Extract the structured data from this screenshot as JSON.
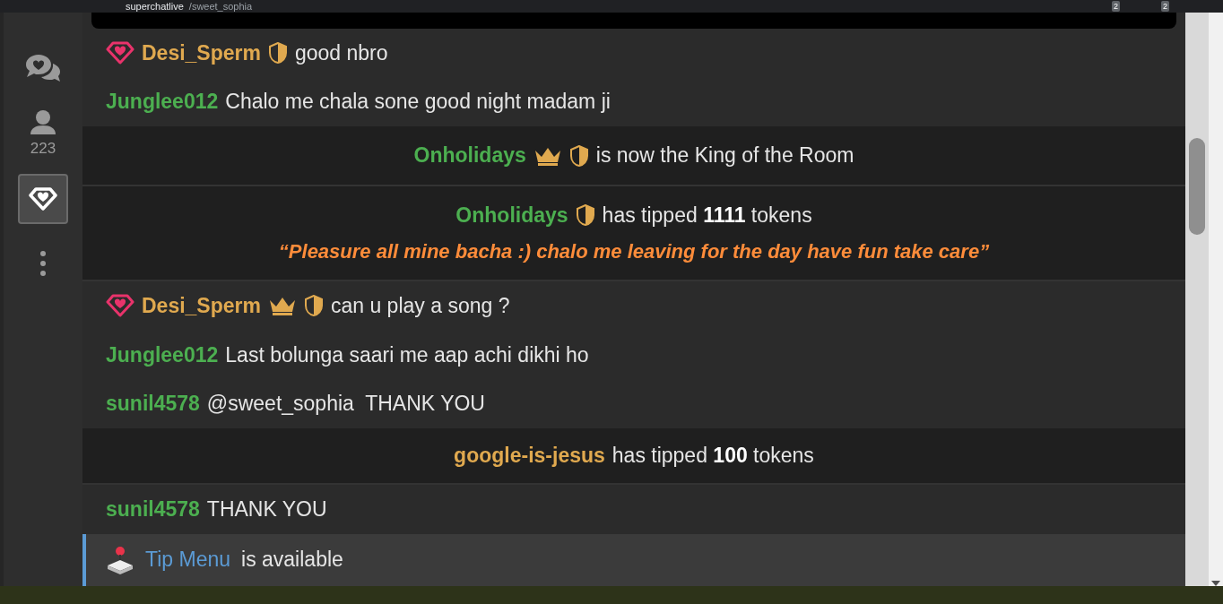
{
  "browser": {
    "url_host": "superchatlive",
    "url_path": "/sweet_sophia",
    "extension_badges": [
      "2",
      "2"
    ]
  },
  "sidebar": {
    "items": [
      {
        "kind": "chat",
        "selected": false
      },
      {
        "kind": "users",
        "count": "223",
        "selected": false
      },
      {
        "kind": "gems",
        "selected": true
      },
      {
        "kind": "more",
        "selected": false
      }
    ]
  },
  "messages": [
    {
      "kind": "chat",
      "user": "Desi_Sperm",
      "color": "#e0a94f",
      "has_heart": true,
      "has_crown": false,
      "has_shield": true,
      "text": "good nbro"
    },
    {
      "kind": "chat",
      "user": "Junglee012",
      "color": "#4caf50",
      "has_heart": false,
      "has_crown": false,
      "has_shield": false,
      "text": "Chalo me chala sone good night madam ji"
    },
    {
      "kind": "notice",
      "user": "Onholidays",
      "color": "#4caf50",
      "has_crown": true,
      "has_shield": true,
      "text": "is now the King of the Room"
    },
    {
      "kind": "tip",
      "user": "Onholidays",
      "color": "#4caf50",
      "has_crown": false,
      "has_shield": true,
      "text": "has tipped **1111** tokens",
      "quote": "“Pleasure all mine bacha :) chalo me leaving for the day have fun take care”"
    },
    {
      "kind": "chat",
      "user": "Desi_Sperm",
      "color": "#e0a94f",
      "has_heart": true,
      "has_crown": true,
      "has_shield": true,
      "text": "can u play a song ?"
    },
    {
      "kind": "chat",
      "user": "Junglee012",
      "color": "#4caf50",
      "has_heart": false,
      "has_crown": false,
      "has_shield": false,
      "text": "Last bolunga saari me aap achi dikhi ho"
    },
    {
      "kind": "chat",
      "user": "sunil4578",
      "color": "#4caf50",
      "has_heart": false,
      "has_crown": false,
      "has_shield": false,
      "text": "@sweet_sophia  THANK YOU"
    },
    {
      "kind": "tip",
      "user": "google-is-jesus",
      "color": "#e0a94f",
      "has_crown": false,
      "has_shield": false,
      "text": "has tipped **100** tokens"
    },
    {
      "kind": "chat",
      "user": "sunil4578",
      "color": "#4caf50",
      "has_heart": false,
      "has_crown": false,
      "has_shield": false,
      "text": "THANK YOU"
    },
    {
      "kind": "info",
      "link": "Tip Menu",
      "text": "is available"
    }
  ]
}
